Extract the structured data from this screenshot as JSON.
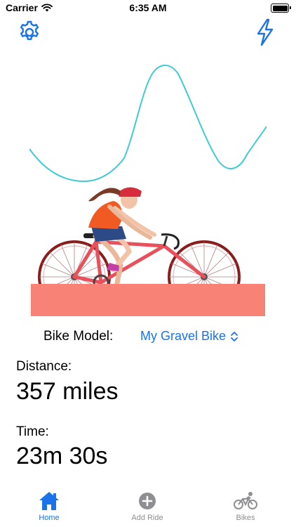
{
  "status": {
    "carrier": "Carrier",
    "time": "6:35 AM"
  },
  "toolbar": {
    "settings_icon": "gear-icon",
    "power_icon": "bolt-icon"
  },
  "colors": {
    "accent": "#1a73e8",
    "elevation_line": "#3ecbd6",
    "ground": "#f98277",
    "tab_inactive": "#8e8e93"
  },
  "bike_model": {
    "label": "Bike Model:",
    "value": "My Gravel Bike"
  },
  "distance": {
    "label": "Distance:",
    "value": "357 miles"
  },
  "time_stat": {
    "label": "Time:",
    "value": "23m 30s"
  },
  "tabs": [
    {
      "label": "Home",
      "icon": "house-icon",
      "selected": true
    },
    {
      "label": "Add Ride",
      "icon": "plus-circle-icon",
      "selected": false
    },
    {
      "label": "Bikes",
      "icon": "bicycle-icon",
      "selected": false
    }
  ]
}
